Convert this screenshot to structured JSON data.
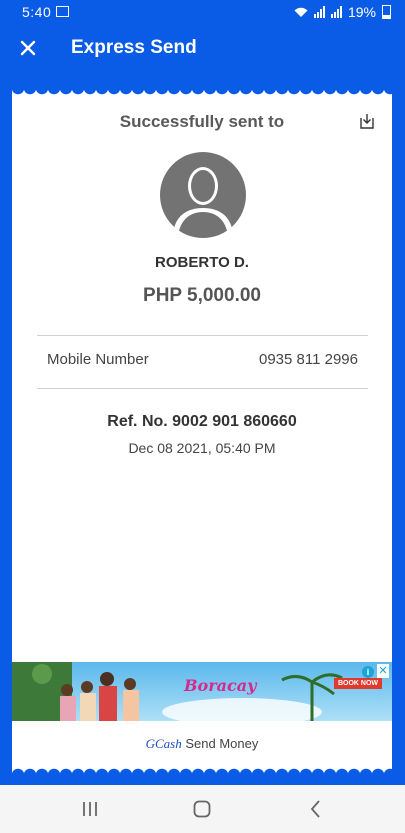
{
  "status_bar": {
    "time": "5:40",
    "battery": "19%"
  },
  "app_bar": {
    "title": "Express Send",
    "close_icon": "close-icon"
  },
  "receipt": {
    "heading": "Successfully sent to",
    "download_icon": "download-icon",
    "recipient_name": "ROBERTO D.",
    "amount": "PHP 5,000.00",
    "details": [
      {
        "label": "Mobile Number",
        "value": "0935 811 2996"
      }
    ],
    "reference": "Ref. No. 9002 901 860660",
    "date": "Dec 08 2021, 05:40 PM",
    "ad": {
      "headline": "Boracay",
      "book_label": "BOOK NOW"
    },
    "footer": {
      "brand": "GCash",
      "text": "Send Money"
    }
  },
  "nav": {
    "recent": "recent-apps-icon",
    "home": "home-icon",
    "back": "back-icon"
  },
  "colors": {
    "primary": "#0a5ce6",
    "background": "#ffffff",
    "text": "#333333"
  }
}
